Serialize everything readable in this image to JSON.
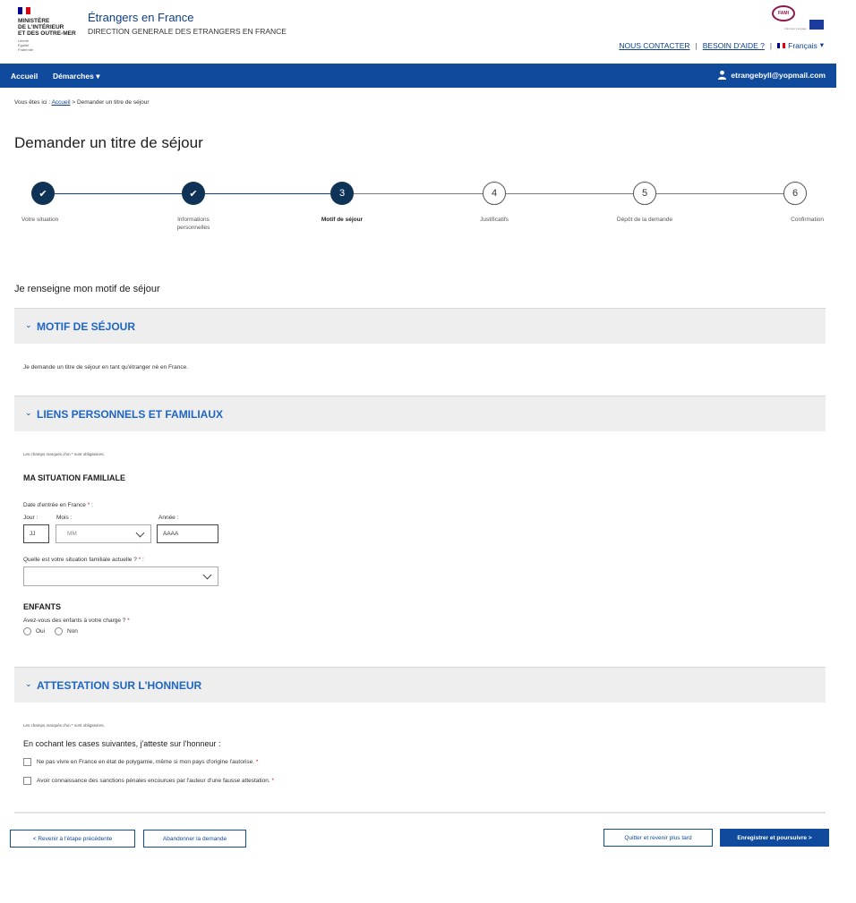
{
  "header": {
    "gov_text_lines": [
      "MINISTÈRE",
      "DE L'INTÉRIEUR",
      "ET DES OUTRE-MER"
    ],
    "gov_motto": [
      "Liberté",
      "Égalité",
      "Fraternité"
    ],
    "site_title": "Étrangers en France",
    "site_subtitle": "DIRECTION GENERALE DES ETRANGERS EN FRANCE",
    "fami_logo": "FAMI",
    "eu_text": "L'Europe s'engage",
    "links": {
      "contact": "NOUS CONTACTER",
      "help": "BESOIN D'AIDE ?",
      "language": "Français"
    },
    "separator": "|",
    "colors": {
      "primary": "#0f4a9c",
      "dark": "#0f3356",
      "accent": "#1f66c4",
      "required": "#c9191e"
    }
  },
  "nav": {
    "home": "Accueil",
    "demarches": "Démarches",
    "demarches_caret": "▾",
    "user_email": "etrangebyll@yopmail.com"
  },
  "breadcrumb": {
    "prefix": "Vous êtes ici :",
    "home": "Accueil",
    "current": "> Demander un titre de séjour"
  },
  "page_title": "Demander un titre de séjour",
  "stepper": {
    "steps": [
      {
        "number": "1",
        "label": "Votre situation",
        "state": "done"
      },
      {
        "number": "2",
        "label": "Informations personnelles",
        "state": "done"
      },
      {
        "number": "3",
        "label": "Motif de séjour",
        "state": "current"
      },
      {
        "number": "4",
        "label": "Justificatifs",
        "state": "todo"
      },
      {
        "number": "5",
        "label": "Dépôt de la demande",
        "state": "todo"
      },
      {
        "number": "6",
        "label": "Confirmation",
        "state": "todo"
      }
    ],
    "check_glyph": "✔"
  },
  "section_heading": "Je renseigne mon motif de séjour",
  "motif": {
    "title": "MOTIF DE SÉJOUR",
    "text": "Je demande un titre de séjour en tant qu'étranger né en France."
  },
  "liens": {
    "title": "LIENS PERSONNELS ET FAMILIAUX",
    "required_note": "Les champs marqués d'un * sont obligatoires.",
    "situation_title": "MA SITUATION FAMILIALE",
    "date_label": "Date d'entrée en France",
    "day_label": "Jour :",
    "month_label": "Mois :",
    "year_label": "Année :",
    "day_placeholder": "JJ",
    "month_placeholder": "MM",
    "year_placeholder": "AAAA",
    "family_question": "Quelle est votre situation familiale actuelle ?",
    "family_value": "",
    "children_title": "ENFANTS",
    "children_question": "Avez-vous des enfants à votre charge ?",
    "yes": "Oui",
    "no": "Non"
  },
  "attestation": {
    "title": "ATTESTATION SUR L'HONNEUR",
    "required_note": "Les champs marqués d'un * sont obligatoires.",
    "intro": "En cochant les cases suivantes, j'atteste sur l'honneur :",
    "items": [
      "Ne pas vivre en France en état de polygamie, même si mon pays d'origine l'autorise.",
      "Avoir connaissance des sanctions pénales encourues par l'auteur d'une fausse attestation."
    ]
  },
  "buttons": {
    "back": "< Revenir à l'étape précédente",
    "abandon": "Abandonner la demande",
    "quit": "Quitter et revenir plus tard",
    "save": "Enregistrer et poursuivre >"
  }
}
